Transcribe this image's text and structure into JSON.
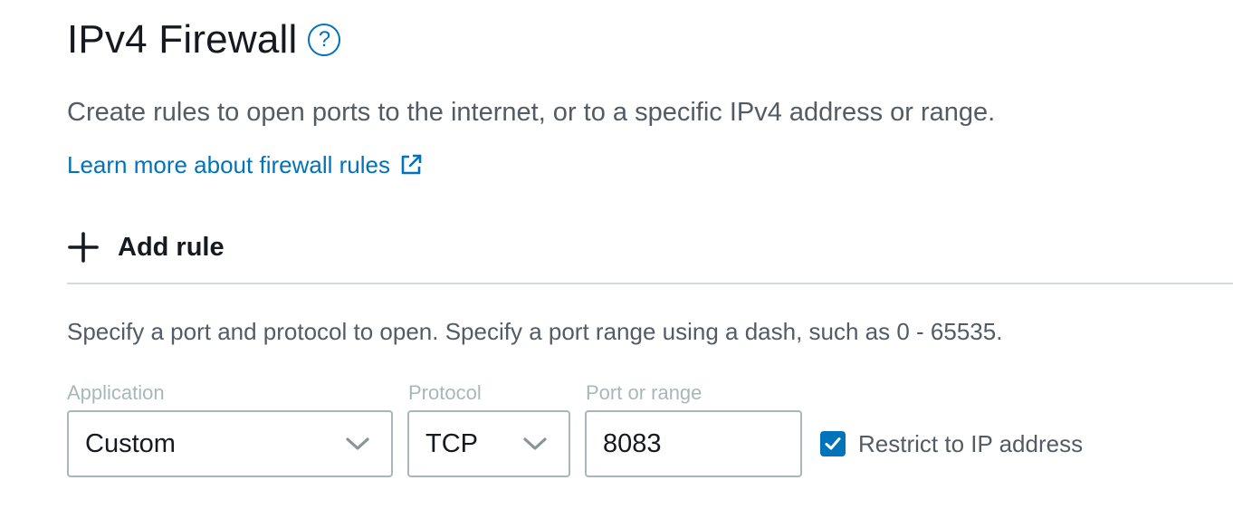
{
  "section": {
    "title": "IPv4 Firewall",
    "help_glyph": "?",
    "description": "Create rules to open ports to the internet, or to a specific IPv4 address or range.",
    "learn_more_link": "Learn more about firewall rules"
  },
  "add_rule": {
    "label": "Add rule"
  },
  "rule_form": {
    "hint": "Specify a port and protocol to open. Specify a port range using a dash, such as 0 - 65535.",
    "application": {
      "label": "Application",
      "value": "Custom"
    },
    "protocol": {
      "label": "Protocol",
      "value": "TCP"
    },
    "port": {
      "label": "Port or range",
      "value": "8083"
    },
    "restrict_ip": {
      "label": "Restrict to IP address",
      "checked": true
    }
  },
  "icons": {
    "help": "help-circle-icon",
    "external_link": "external-link-icon",
    "add": "plus-icon",
    "dropdown": "chevron-down-icon",
    "checkbox": "checkmark-icon"
  },
  "colors": {
    "link": "#0073bb",
    "heading": "#16191f",
    "body_text": "#545b64",
    "label_muted": "#aab7b8",
    "border": "#aab7b8",
    "divider": "#d5dbdb",
    "checkbox": "#0073bb"
  }
}
